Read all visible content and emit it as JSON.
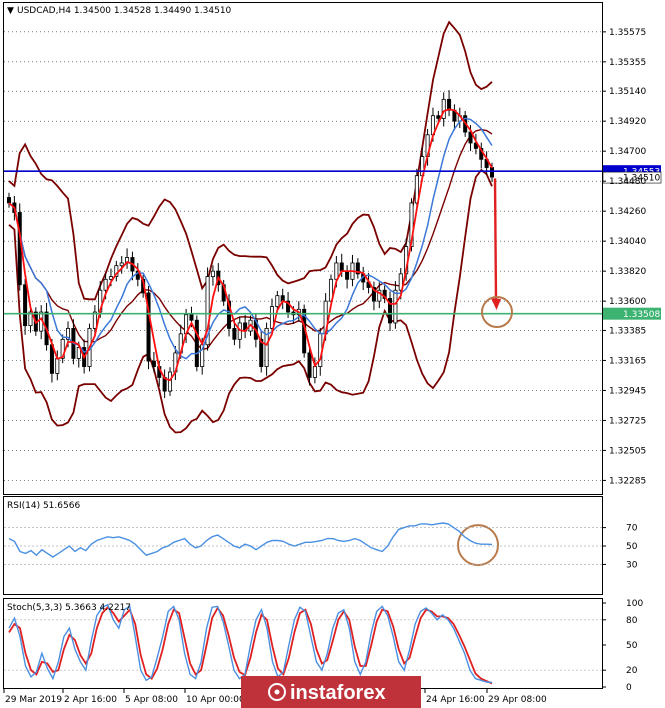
{
  "chart_data": {
    "type": "candlestick",
    "symbol_line": "USDCAD,H4  1.34500 1.34528 1.34490 1.34510",
    "x_tick_labels": [
      "29 Mar 2019",
      "2 Apr 16:00",
      "5 Apr 08:00",
      "10 Apr 00:00",
      "24 Apr 16:00",
      "29 Apr 08:00"
    ],
    "price_axis": {
      "ylim": [
        1.322,
        1.3575
      ],
      "tick_labels": [
        "1.35575",
        "1.35355",
        "1.35140",
        "1.34920",
        "1.34700",
        "1.34480",
        "1.34260",
        "1.34040",
        "1.33820",
        "1.33600",
        "1.33385",
        "1.33165",
        "1.32945",
        "1.32725",
        "1.32505",
        "1.32285"
      ],
      "hlines": [
        {
          "label": "1.34553",
          "value": 1.34553,
          "color": "#0000cc"
        },
        {
          "label": "1.33508",
          "value": 1.33508,
          "color": "#3cb371"
        }
      ],
      "current_price_label": "1.34510",
      "current_price": 1.3451
    },
    "closes": [
      1.3432,
      1.3425,
      1.3372,
      1.3342,
      1.3352,
      1.3338,
      1.3352,
      1.3328,
      1.3307,
      1.3318,
      1.3332,
      1.334,
      1.3318,
      1.3326,
      1.3312,
      1.334,
      1.3352,
      1.3368,
      1.3376,
      1.3378,
      1.3386,
      1.3388,
      1.3392,
      1.3382,
      1.3376,
      1.3366,
      1.3316,
      1.3312,
      1.3304,
      1.3294,
      1.3308,
      1.3322,
      1.3336,
      1.335,
      1.3346,
      1.3312,
      1.3328,
      1.3378,
      1.3382,
      1.3372,
      1.336,
      1.334,
      1.3332,
      1.3344,
      1.3338,
      1.3346,
      1.3332,
      1.3312,
      1.334,
      1.3356,
      1.3364,
      1.336,
      1.3352,
      1.335,
      1.3354,
      1.3322,
      1.3304,
      1.3312,
      1.3336,
      1.336,
      1.3376,
      1.3388,
      1.3382,
      1.3376,
      1.3388,
      1.338,
      1.3374,
      1.337,
      1.336,
      1.3368,
      1.3362,
      1.3344,
      1.3368,
      1.338,
      1.34,
      1.3432,
      1.3452,
      1.3466,
      1.3482,
      1.3496,
      1.3494,
      1.3508,
      1.35,
      1.3492,
      1.3496,
      1.3484,
      1.3476,
      1.3472,
      1.3464,
      1.3458,
      1.3451
    ],
    "sub_panels": [
      {
        "title": "RSI(14) 51.6566",
        "ylim": [
          0,
          100
        ],
        "tick_labels": [
          "70",
          "50",
          "30"
        ],
        "levels": [
          70,
          50,
          30
        ],
        "values": [
          58,
          55,
          44,
          42,
          45,
          40,
          46,
          42,
          38,
          42,
          46,
          50,
          44,
          48,
          45,
          52,
          56,
          58,
          60,
          59,
          60,
          58,
          56,
          52,
          46,
          40,
          42,
          44,
          48,
          50,
          54,
          56,
          58,
          52,
          48,
          50,
          56,
          60,
          62,
          58,
          54,
          50,
          48,
          52,
          50,
          46,
          50,
          54,
          56,
          56,
          55,
          52,
          50,
          52,
          54,
          54,
          55,
          56,
          58,
          58,
          56,
          55,
          56,
          58,
          56,
          52,
          48,
          46,
          44,
          50,
          60,
          68,
          70,
          72,
          72,
          74,
          74,
          73,
          74,
          75,
          74,
          70,
          66,
          60,
          56,
          53,
          52,
          52,
          51.66
        ]
      },
      {
        "title": "Stoch(5,3,3) 5.3663 4.2217",
        "ylim": [
          0,
          100
        ],
        "tick_labels": [
          "100",
          "80",
          "50",
          "20",
          "0"
        ],
        "levels": [
          80,
          20
        ],
        "main": [
          70,
          82,
          60,
          25,
          12,
          18,
          40,
          22,
          10,
          30,
          60,
          70,
          45,
          30,
          20,
          55,
          85,
          95,
          98,
          80,
          70,
          92,
          96,
          60,
          20,
          8,
          12,
          35,
          60,
          90,
          96,
          80,
          40,
          15,
          10,
          30,
          70,
          95,
          96,
          78,
          50,
          20,
          10,
          15,
          50,
          80,
          92,
          70,
          30,
          12,
          18,
          50,
          80,
          95,
          90,
          60,
          30,
          20,
          40,
          70,
          88,
          92,
          70,
          30,
          15,
          30,
          65,
          90,
          96,
          85,
          60,
          30,
          20,
          45,
          75,
          90,
          94,
          88,
          80,
          86,
          80,
          70,
          55,
          40,
          20,
          10,
          8,
          6,
          5.37
        ],
        "signal": [
          65,
          75,
          70,
          40,
          20,
          15,
          30,
          28,
          18,
          20,
          45,
          62,
          56,
          38,
          28,
          40,
          70,
          88,
          95,
          88,
          78,
          85,
          92,
          75,
          38,
          15,
          10,
          22,
          45,
          75,
          92,
          88,
          58,
          28,
          15,
          20,
          50,
          82,
          94,
          85,
          62,
          35,
          18,
          14,
          35,
          65,
          86,
          80,
          48,
          22,
          15,
          35,
          65,
          88,
          92,
          75,
          45,
          28,
          32,
          55,
          80,
          90,
          80,
          48,
          25,
          25,
          50,
          78,
          92,
          90,
          72,
          45,
          28,
          35,
          60,
          82,
          92,
          90,
          84,
          84,
          82,
          75,
          62,
          48,
          32,
          16,
          10,
          7,
          4.22
        ]
      }
    ],
    "annotations": [
      {
        "type": "arrow",
        "color": "#e02020",
        "from_price": 1.345,
        "to_price": 1.3355
      },
      {
        "type": "circle",
        "color": "#b87a4b",
        "panel": "price",
        "center_price": 1.3352
      },
      {
        "type": "circle",
        "color": "#b87a4b",
        "panel": "rsi",
        "center_value": 51
      }
    ],
    "indicators": [
      "Bollinger Bands (dark red)",
      "Moving average (red)",
      "Moving average (blue)"
    ],
    "colors": {
      "bull": "#ffffff",
      "bear": "#000000",
      "bb": "#7a0000",
      "ma_fast": "#ff1010",
      "ma_slow": "#3c78d8",
      "rsi": "#4a90e2",
      "stoch_main": "#4a90e2",
      "stoch_signal": "#e02020"
    }
  },
  "watermark": "instaforex"
}
